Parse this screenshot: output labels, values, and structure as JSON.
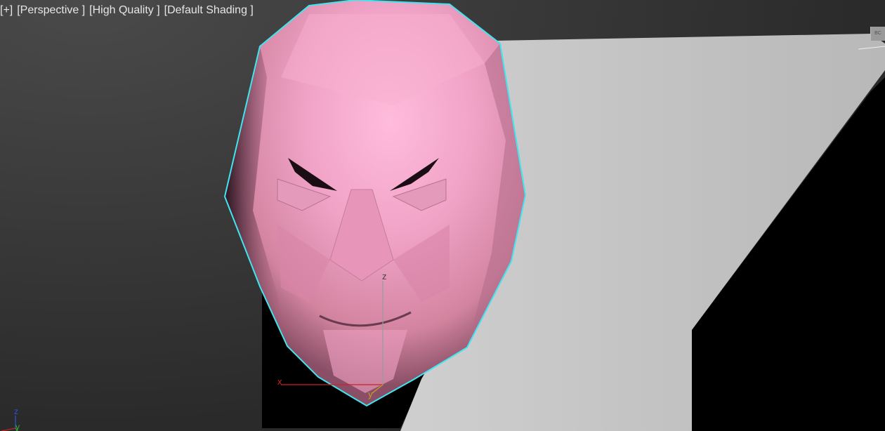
{
  "viewport": {
    "labels": {
      "plus_menu": "[+]",
      "view_menu": "[Perspective ]",
      "quality_menu": "[High Quality ]",
      "shading_menu": "[Default Shading ]"
    },
    "corner_button_text": "BC",
    "gizmo": {
      "z": "z",
      "x": "x",
      "y": "y"
    },
    "world_axis": {
      "z": "z",
      "y": "y"
    }
  },
  "colors": {
    "selection_outline": "#3fe6f0",
    "face_main": "#f0a6c8",
    "face_shadow": "#3a1f2c",
    "plane": "#bcbcbc",
    "gizmo_x": "#cc2222",
    "gizmo_y": "#c8a020",
    "gizmo_z": "#9a9a9a",
    "world_z": "#3050e0",
    "world_y": "#30b030"
  },
  "icons": {
    "gizmo": "transform-gizmo-icon",
    "world_axis": "world-axis-tripod-icon"
  }
}
